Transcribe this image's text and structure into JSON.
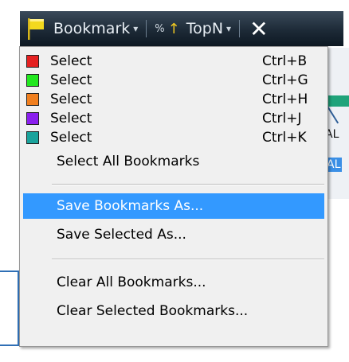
{
  "toolbar": {
    "bookmark_label": "Bookmark",
    "bookmark_caret": "▾",
    "pct_glyph": "%",
    "arrow_glyph": "↑",
    "topn_label": "TopN",
    "topn_caret": "▾",
    "close_glyph": "✕"
  },
  "background": {
    "right_text_1": "AL",
    "right_text_2": "AL"
  },
  "menu": {
    "color_items": [
      {
        "label": "Select",
        "shortcut": "Ctrl+B",
        "color": "#e52121"
      },
      {
        "label": "Select",
        "shortcut": "Ctrl+G",
        "color": "#22e81f"
      },
      {
        "label": "Select",
        "shortcut": "Ctrl+H",
        "color": "#f07f1f"
      },
      {
        "label": "Select",
        "shortcut": "Ctrl+J",
        "color": "#8a1fee"
      },
      {
        "label": "Select",
        "shortcut": "Ctrl+K",
        "color": "#1aa39c"
      }
    ],
    "select_all": "Select All Bookmarks",
    "save_as": "Save Bookmarks As...",
    "save_selected": "Save Selected As...",
    "clear_all": "Clear All Bookmarks...",
    "clear_selected": "Clear Selected Bookmarks..."
  },
  "colors": {
    "highlight": "#3399ff",
    "toolbar_bg": "#1d2a37",
    "flag": "#f0d020"
  }
}
